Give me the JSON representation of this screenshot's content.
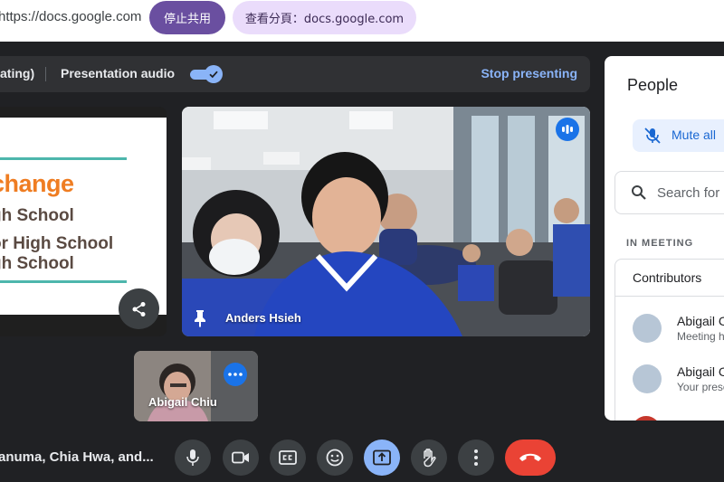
{
  "share_bar": {
    "url_text": "https://docs.google.com",
    "stop_sharing_label": "停止共用",
    "view_tab_label": "查看分頁：docs.google.com"
  },
  "presenting_bar": {
    "status_text": "ating)",
    "audio_label": "Presentation audio",
    "audio_enabled": true,
    "stop_presenting_label": "Stop presenting"
  },
  "slide": {
    "title": "change",
    "lines": [
      "gh School",
      "or High School",
      "gh School"
    ]
  },
  "main_tile": {
    "name": "Anders Hsieh",
    "speaking": true,
    "pinned": true
  },
  "self_tile": {
    "name": "Abigail Chiu"
  },
  "people_panel": {
    "title": "People",
    "mute_all_label": "Mute all",
    "search_placeholder": "Search for",
    "section_label": "IN MEETING",
    "group_label": "Contributors",
    "participants": [
      {
        "name": "Abigail C",
        "subtitle": "Meeting h"
      },
      {
        "name": "Abigail C",
        "subtitle": "Your prese"
      }
    ]
  },
  "bottom_bar": {
    "meeting_names": "anuma, Chia Hwa, and..."
  },
  "controls": [
    {
      "icon": "mic-icon",
      "active": false
    },
    {
      "icon": "camera-icon",
      "active": false
    },
    {
      "icon": "captions-icon",
      "active": false
    },
    {
      "icon": "emoji-icon",
      "active": false
    },
    {
      "icon": "present-screen-icon",
      "active": true
    },
    {
      "icon": "raise-hand-icon",
      "active": false
    },
    {
      "icon": "more-options-icon",
      "active": false
    },
    {
      "icon": "leave-call-icon",
      "active": false
    }
  ],
  "colors": {
    "background": "#202124",
    "accent": "#8ab4f8",
    "stop_share": "#6a4fa0",
    "leave": "#ea4335",
    "slide_orange": "#ef7d22",
    "slide_teal": "#4db6ac"
  }
}
